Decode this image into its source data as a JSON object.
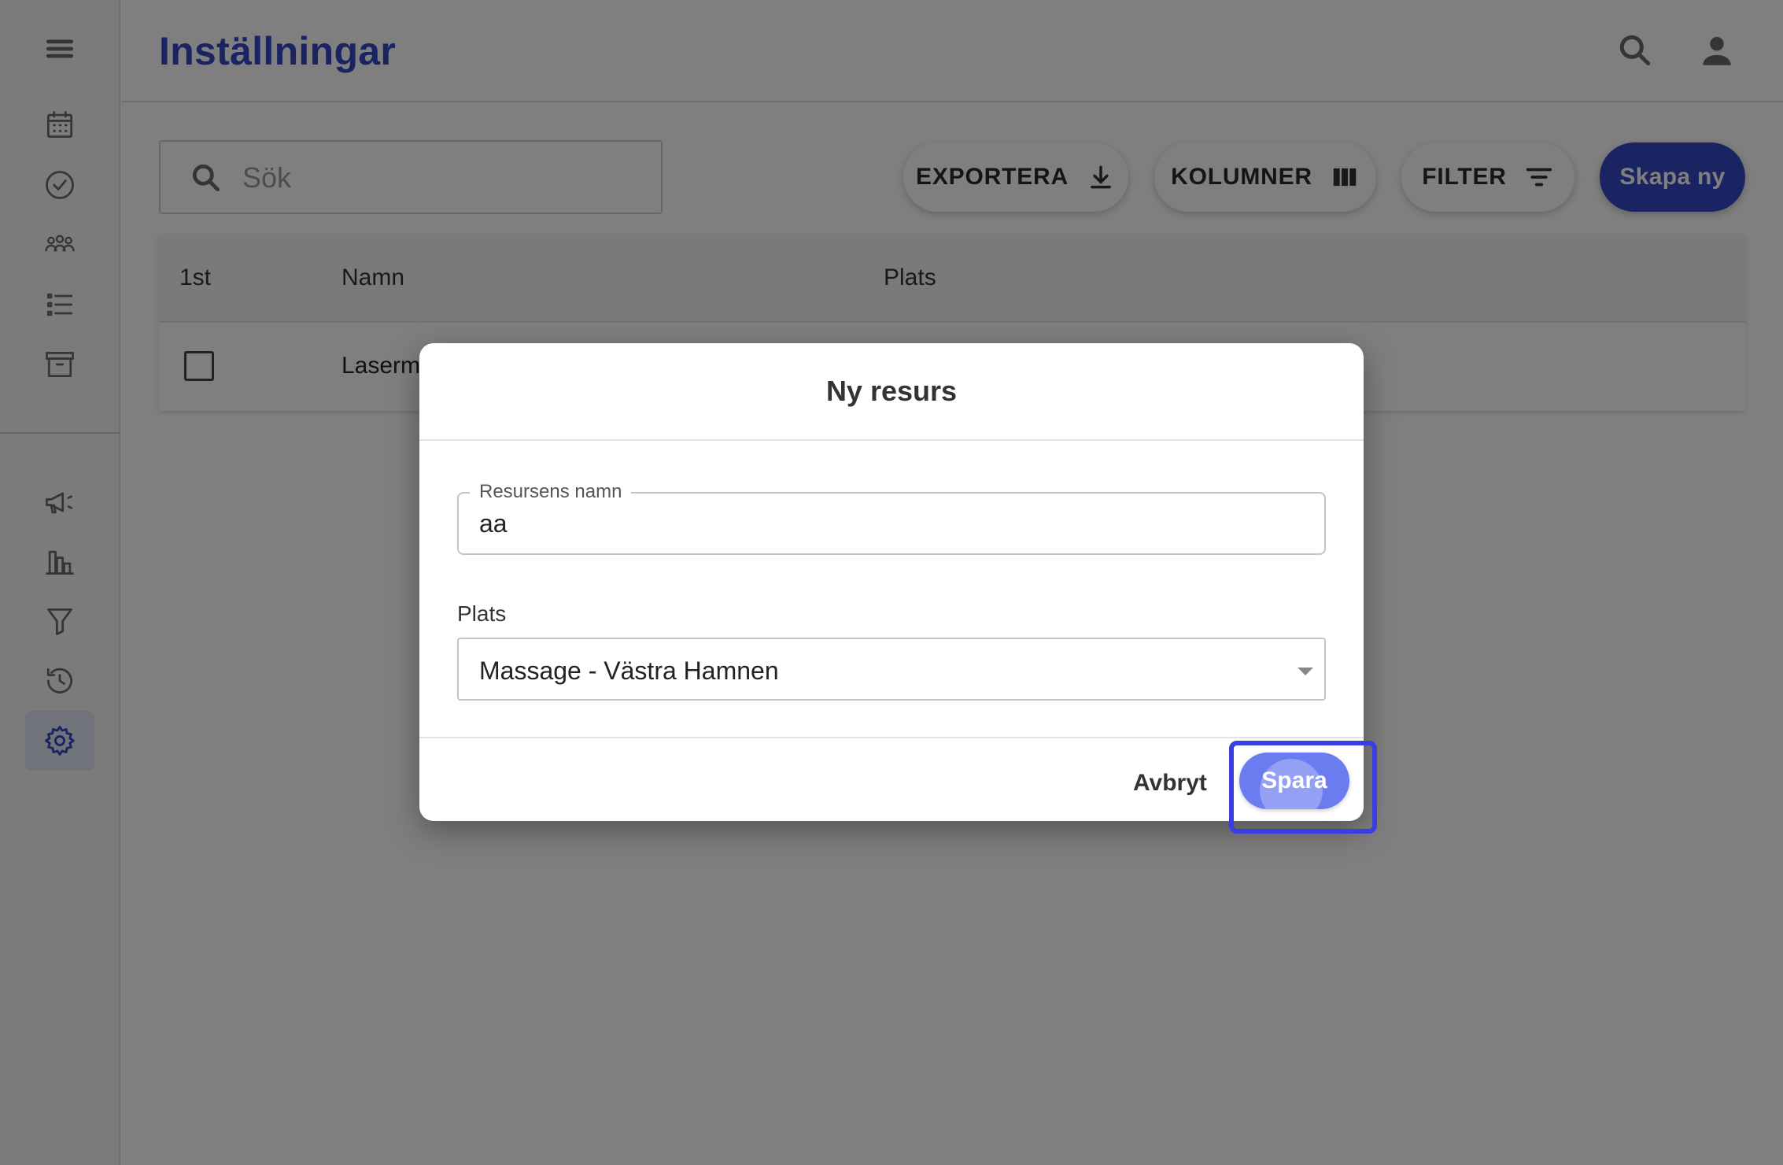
{
  "header": {
    "title": "Inställningar",
    "search_icon": "search-icon",
    "account_icon": "account-icon"
  },
  "sidebar": {
    "items": [
      {
        "icon": "menu-icon"
      },
      {
        "icon": "calendar-icon"
      },
      {
        "icon": "check-circle-icon"
      },
      {
        "icon": "group-icon"
      },
      {
        "icon": "list-icon"
      },
      {
        "icon": "archive-icon"
      },
      {
        "icon": "megaphone-icon"
      },
      {
        "icon": "bar-chart-icon"
      },
      {
        "icon": "filter-icon"
      },
      {
        "icon": "history-icon"
      },
      {
        "icon": "settings-icon",
        "active": true
      }
    ]
  },
  "toolbar": {
    "search_placeholder": "Sök",
    "export_label": "EXPORTERA",
    "columns_label": "KOLUMNER",
    "filter_label": "FILTER",
    "create_label": "Skapa ny"
  },
  "table": {
    "columns": [
      "1st",
      "Namn",
      "Plats"
    ],
    "rows": [
      {
        "name": "Laserm",
        "plats": ""
      }
    ]
  },
  "dialog": {
    "title": "Ny resurs",
    "name_label": "Resursens namn",
    "name_value": "aa",
    "plats_label": "Plats",
    "plats_value": "Massage - Västra Hamnen",
    "cancel_label": "Avbryt",
    "save_label": "Spara"
  },
  "colors": {
    "accent": "#3649c5",
    "save_button": "#6a7cf0",
    "focus_ring": "#3a3ee0",
    "overlay": "rgba(0,0,0,0.5)"
  }
}
